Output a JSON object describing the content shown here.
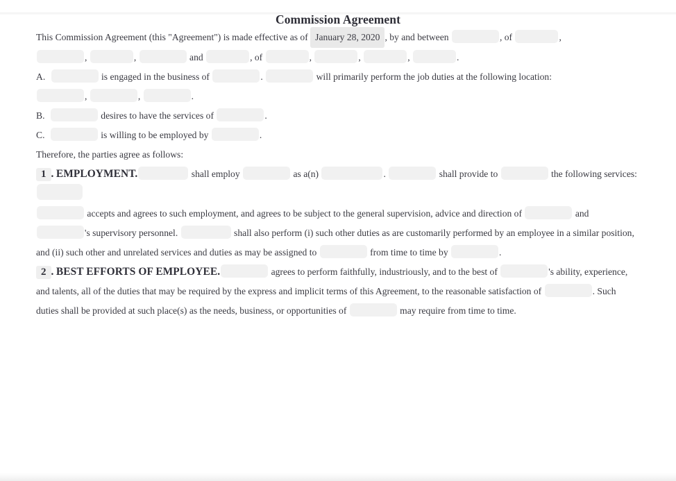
{
  "document": {
    "title": "Commission Agreement",
    "intro": {
      "t1": "This Commission Agreement (this \"Agreement\") is made effective as of",
      "effective_date": "January 28, 2020",
      "t2": ", by and between",
      "t3": ", of",
      "t4": ",",
      "t5": ",",
      "t6": ",",
      "t7": "and",
      "t8": ", of",
      "t9": ",",
      "t10": ",",
      "t11": ",",
      "t12": "."
    },
    "recitals": [
      {
        "letter": "A.",
        "t1": "is engaged in the business of",
        "t2": ".",
        "t3": "will primarily perform the job duties at the following location:",
        "t4": ",",
        "t5": ",",
        "t6": "."
      },
      {
        "letter": "B.",
        "t1": "desires to have the services of",
        "t2": "."
      },
      {
        "letter": "C.",
        "t1": "is willing to be employed by",
        "t2": "."
      }
    ],
    "therefore": "Therefore, the parties agree as follows:",
    "sections": [
      {
        "number": "1",
        "dot": ".",
        "heading": "EMPLOYMENT.",
        "t1": "shall employ",
        "t2": "as a(n)",
        "t3": ".",
        "t4": "shall provide to",
        "t5": "the following services:",
        "t6": "accepts and agrees to such employment, and agrees to be subject to the general supervision, advice and direction of",
        "t7": "and",
        "t8": "'s supervisory personnel.",
        "t9": "shall also perform (i) such other duties as are customarily performed by an employee in a similar position, and (ii) such other and unrelated services and duties as may be assigned to",
        "t10": "from time to time by",
        "t11": "."
      },
      {
        "number": "2",
        "dot": ".",
        "heading": "BEST EFFORTS OF EMPLOYEE.",
        "t1": "agrees to perform faithfully, industriously, and to the best of",
        "t2": "'s ability, experience, and talents, all of the duties that may be required by the express and implicit terms of this Agreement, to the reasonable satisfaction of",
        "t3": ". Such duties shall be provided at such place(s) as the needs, business, or opportunities of",
        "t4": "may require from time to time."
      }
    ]
  }
}
